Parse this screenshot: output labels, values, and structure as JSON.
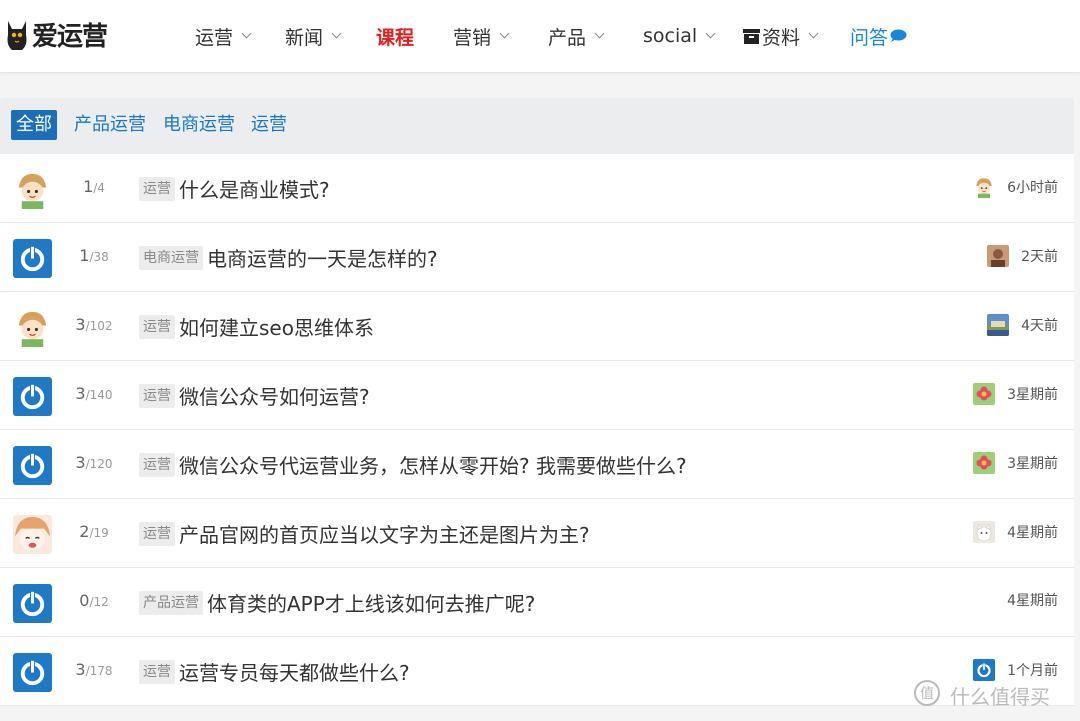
{
  "logo": {
    "text": "爱运营"
  },
  "nav": {
    "items": [
      {
        "label": "运营",
        "has_menu": true
      },
      {
        "label": "新闻",
        "has_menu": true
      },
      {
        "label": "课程",
        "has_menu": false
      },
      {
        "label": "营销",
        "has_menu": true
      },
      {
        "label": "产品",
        "has_menu": true
      },
      {
        "label": "social",
        "has_menu": true
      },
      {
        "label": "资料",
        "has_menu": true,
        "icon": "archive-box-icon"
      },
      {
        "label": "问答",
        "has_menu": false,
        "icon": "chat-bubble-icon"
      }
    ]
  },
  "filters": {
    "items": [
      {
        "label": "全部",
        "active": true
      },
      {
        "label": "产品运营",
        "active": false
      },
      {
        "label": "电商运营",
        "active": false
      },
      {
        "label": "运营",
        "active": false
      }
    ]
  },
  "questions": [
    {
      "avatar": "cartoon-girl-avatar",
      "answers": "1",
      "views": "/4",
      "tag": "运营",
      "title": "什么是商业模式?",
      "last_avatar": "cartoon-girl-avatar",
      "time": "6小时前"
    },
    {
      "avatar": "power-icon-avatar",
      "answers": "1",
      "views": "/38",
      "tag": "电商运营",
      "title": "电商运营的一天是怎样的?",
      "last_avatar": "photo-avatar",
      "time": "2天前"
    },
    {
      "avatar": "cartoon-girl-avatar",
      "answers": "3",
      "views": "/102",
      "tag": "运营",
      "title": "如何建立seo思维体系",
      "last_avatar": "landscape-avatar",
      "time": "4天前"
    },
    {
      "avatar": "power-icon-avatar",
      "answers": "3",
      "views": "/140",
      "tag": "运营",
      "title": "微信公众号如何运营?",
      "last_avatar": "flower-avatar",
      "time": "3星期前"
    },
    {
      "avatar": "power-icon-avatar",
      "answers": "3",
      "views": "/120",
      "tag": "运营",
      "title": "微信公众号代运营业务，怎样从零开始? 我需要做些什么?",
      "last_avatar": "flower-avatar",
      "time": "3星期前"
    },
    {
      "avatar": "anime-girl-avatar",
      "answers": "2",
      "views": "/19",
      "tag": "运营",
      "title": "产品官网的首页应当以文字为主还是图片为主?",
      "last_avatar": "white-cat-avatar",
      "time": "4星期前"
    },
    {
      "avatar": "power-icon-avatar",
      "answers": "0",
      "views": "/12",
      "tag": "产品运营",
      "title": "体育类的APP才上线该如何去推广呢?",
      "last_avatar": "",
      "time": "4星期前"
    },
    {
      "avatar": "power-icon-avatar",
      "answers": "3",
      "views": "/178",
      "tag": "运营",
      "title": "运营专员每天都做些什么?",
      "last_avatar": "power-icon-avatar",
      "time": "1个月前"
    }
  ],
  "watermark": {
    "text": "什么值得买"
  },
  "colors": {
    "link": "#1a78c2",
    "active_filter": "#1a6fb8",
    "course": "#e02020",
    "power_avatar": "#1f79c4"
  }
}
